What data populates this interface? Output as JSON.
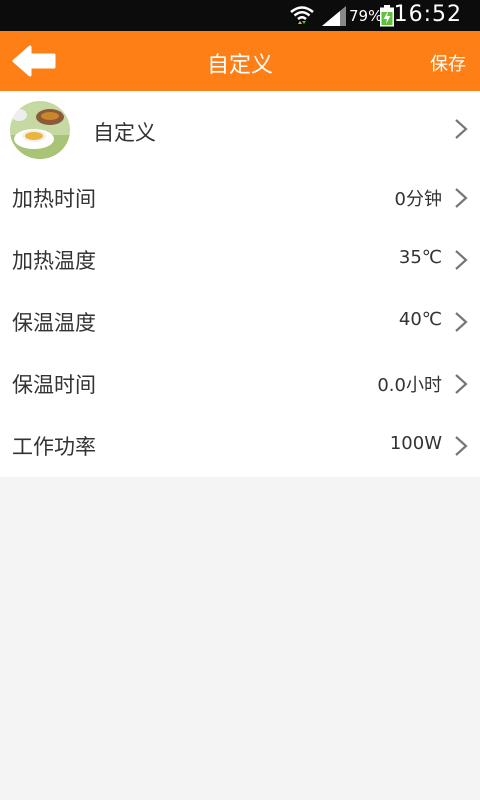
{
  "status": {
    "battery": "79%",
    "time": "16:52"
  },
  "header": {
    "title": "自定义",
    "save_label": "保存"
  },
  "profile": {
    "label": "自定义"
  },
  "settings": [
    {
      "label": "加热时间",
      "value": "0分钟"
    },
    {
      "label": "加热温度",
      "value": "35℃"
    },
    {
      "label": "保温温度",
      "value": "40℃"
    },
    {
      "label": "保温时间",
      "value": "0.0小时"
    },
    {
      "label": "工作功率",
      "value": "100W"
    }
  ],
  "colors": {
    "accent": "#ff7f17",
    "statusbar": "#0c0c0c",
    "background": "#f4f4f4"
  },
  "icons": [
    "wifi-icon",
    "signal-icon",
    "battery-icon",
    "back-arrow-icon",
    "chevron-right-icon"
  ]
}
